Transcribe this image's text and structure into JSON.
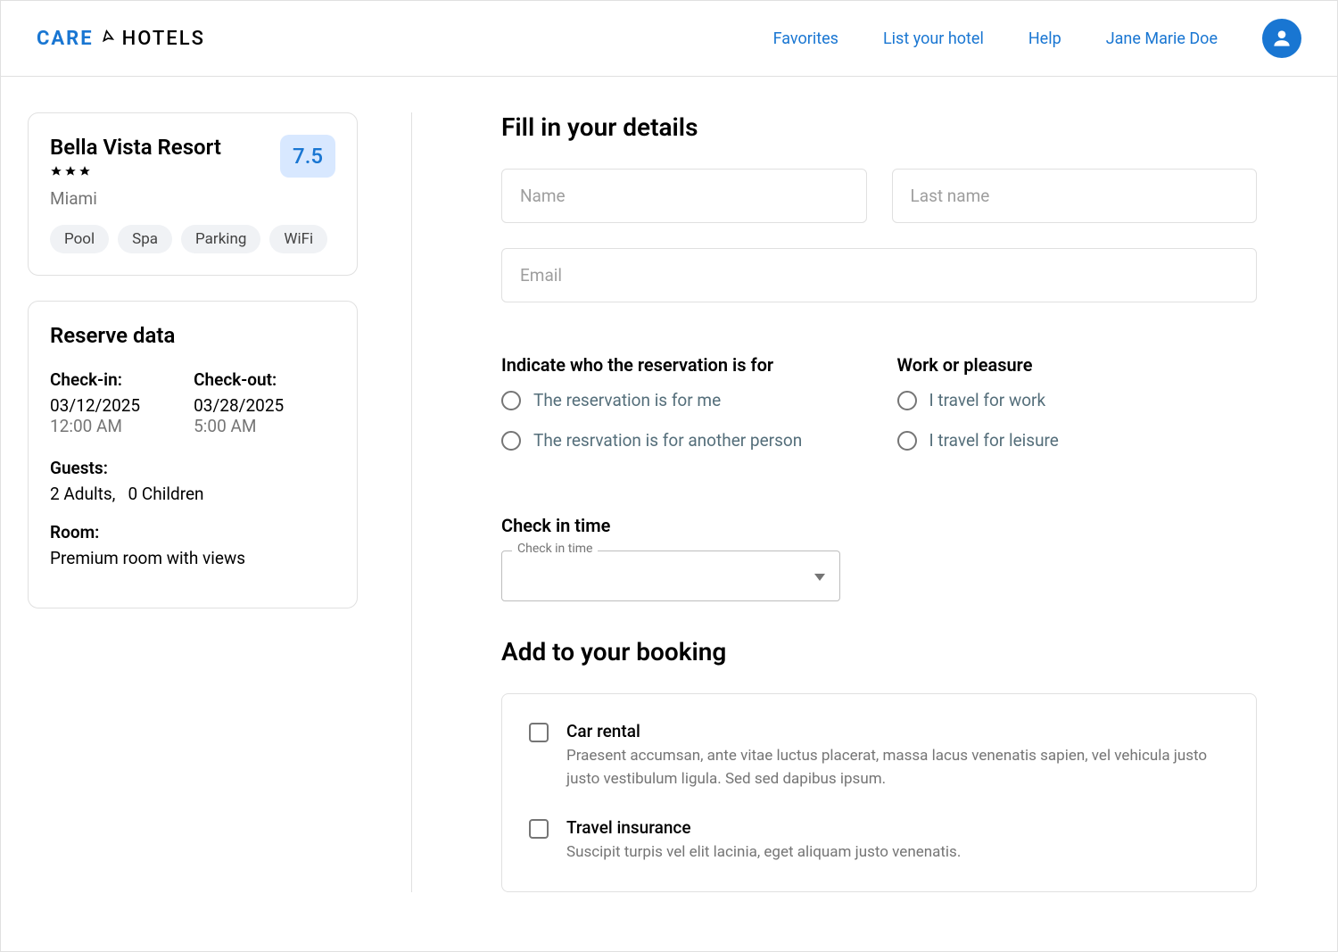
{
  "header": {
    "logo_care": "CARE",
    "logo_hotels": "HOTELS",
    "nav": {
      "favorites": "Favorites",
      "list_your_hotel": "List your hotel",
      "help": "Help",
      "user_name": "Jane Marie Doe"
    }
  },
  "hotel_card": {
    "name": "Bella Vista Resort",
    "rating": "7.5",
    "location": "Miami",
    "amenities": [
      "Pool",
      "Spa",
      "Parking",
      "WiFi"
    ]
  },
  "reserve": {
    "title": "Reserve data",
    "checkin_label": "Check-in:",
    "checkin_date": "03/12/2025",
    "checkin_time": "12:00 AM",
    "checkout_label": "Check-out:",
    "checkout_date": "03/28/2025",
    "checkout_time": "5:00 AM",
    "guests_label": "Guests:",
    "adults_count": "2",
    "adults_label": "Adults,",
    "children_count": "0",
    "children_label": "Children",
    "room_label": "Room:",
    "room_value": "Premium room with views"
  },
  "details": {
    "title": "Fill in your details",
    "name_placeholder": "Name",
    "lastname_placeholder": "Last name",
    "email_placeholder": "Email",
    "reservation_for_title": "Indicate who the reservation is for",
    "reservation_for_me": "The reservation is for me",
    "reservation_for_other": "The resrvation is for another person",
    "work_pleasure_title": "Work or pleasure",
    "travel_work": "I travel for work",
    "travel_leisure": "I travel for leisure",
    "checkin_time_title": "Check in time",
    "checkin_time_label": "Check in time"
  },
  "booking_addons": {
    "title": "Add to your booking",
    "car_rental": {
      "title": "Car rental",
      "desc": "Praesent accumsan, ante vitae luctus placerat, massa lacus venenatis sapien, vel vehicula justo justo vestibulum ligula. Sed sed dapibus ipsum."
    },
    "travel_insurance": {
      "title": "Travel insurance",
      "desc": "Suscipit turpis vel elit lacinia, eget aliquam justo venenatis."
    }
  }
}
